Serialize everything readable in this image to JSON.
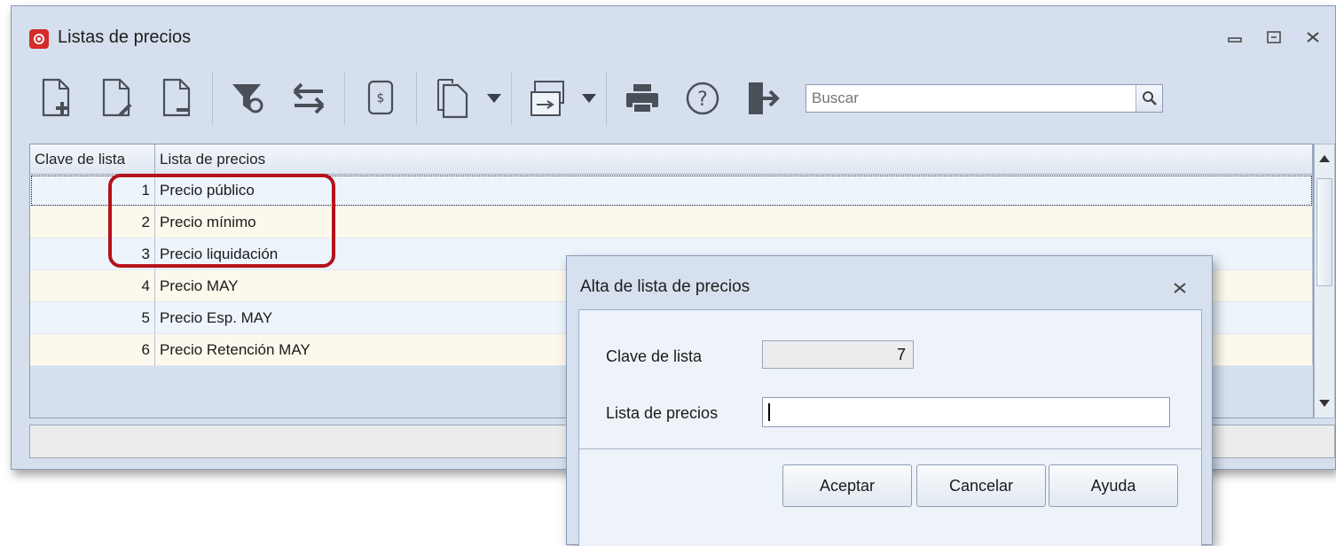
{
  "window": {
    "title": "Listas de precios",
    "controls": {
      "minimize": "minimize-icon",
      "maximize": "maximize-icon",
      "close": "close-icon"
    }
  },
  "toolbar": {
    "items": [
      "new-document-icon",
      "edit-document-icon",
      "delete-document-icon",
      "filter-refresh-icon",
      "transfer-icon",
      "price-list-icon",
      "copy-icon",
      "window-layout-icon",
      "print-icon",
      "help-icon",
      "exit-icon"
    ],
    "search_placeholder": "Buscar"
  },
  "grid": {
    "columns": [
      "Clave de lista",
      "Lista de precios"
    ],
    "rows": [
      {
        "key": "1",
        "name": "Precio público"
      },
      {
        "key": "2",
        "name": "Precio mínimo"
      },
      {
        "key": "3",
        "name": "Precio liquidación"
      },
      {
        "key": "4",
        "name": "Precio MAY"
      },
      {
        "key": "5",
        "name": "Precio Esp. MAY"
      },
      {
        "key": "6",
        "name": "Precio Retención MAY"
      }
    ]
  },
  "dialog": {
    "title": "Alta de lista de precios",
    "key_label": "Clave de lista",
    "key_value": "7",
    "name_label": "Lista de precios",
    "name_value": "",
    "buttons": {
      "accept": "Aceptar",
      "cancel": "Cancelar",
      "help": "Ayuda"
    }
  },
  "colors": {
    "window_bg": "#d5dfed",
    "row_odd": "#eef4fb",
    "row_even": "#fcf8ec",
    "highlight": "#b5121b",
    "icon": "#4a4f58"
  }
}
